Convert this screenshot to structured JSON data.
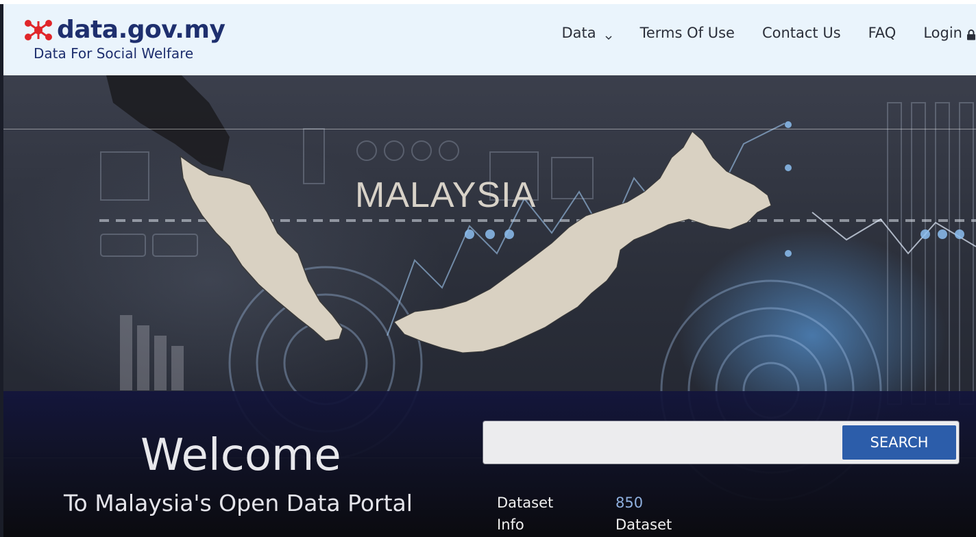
{
  "header": {
    "logo_text": "data.gov.my",
    "tagline": "Data For Social Welfare",
    "colors": {
      "brand": "#1e2f6e",
      "logo_mark": "#e0262a",
      "background": "#eaf4fc"
    }
  },
  "nav": {
    "items": [
      {
        "label": "Data",
        "icon": "chevron-down-icon"
      },
      {
        "label": "Terms Of Use"
      },
      {
        "label": "Contact Us"
      },
      {
        "label": "FAQ"
      },
      {
        "label": "Login",
        "icon": "lock-icon"
      }
    ]
  },
  "hero": {
    "banner_text": "MALAYSIA",
    "welcome": "Welcome",
    "subtitle": "To Malaysia's Open Data Portal",
    "search": {
      "placeholder": "",
      "value": "",
      "button_label": "SEARCH",
      "button_color": "#2c5daa"
    },
    "dataset_info": {
      "label_line1": "Dataset",
      "label_line2": "Info",
      "count": "850",
      "unit": "Dataset"
    }
  }
}
